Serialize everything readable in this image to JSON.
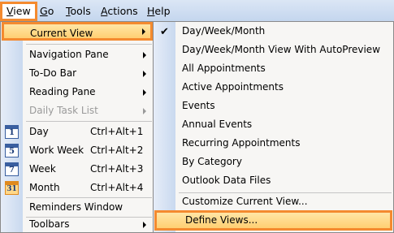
{
  "menubar": {
    "items": [
      {
        "label": "View",
        "accel": "V"
      },
      {
        "label": "Go",
        "accel": "G"
      },
      {
        "label": "Tools",
        "accel": "T"
      },
      {
        "label": "Actions",
        "accel": "A"
      },
      {
        "label": "Help",
        "accel": "H"
      }
    ]
  },
  "view_menu": {
    "items": [
      {
        "label": "Current View",
        "has_submenu": true,
        "highlighted": true
      },
      {
        "label": "Navigation Pane",
        "has_submenu": true
      },
      {
        "label": "To-Do Bar",
        "has_submenu": true
      },
      {
        "label": "Reading Pane",
        "has_submenu": true
      },
      {
        "label": "Daily Task List",
        "has_submenu": true,
        "disabled": true
      },
      {
        "label": "Day",
        "shortcut": "Ctrl+Alt+1",
        "icon": "calendar-day-icon",
        "icon_text": "1"
      },
      {
        "label": "Work Week",
        "shortcut": "Ctrl+Alt+2",
        "icon": "calendar-work-week-icon",
        "icon_text": "5"
      },
      {
        "label": "Week",
        "shortcut": "Ctrl+Alt+3",
        "icon": "calendar-week-icon",
        "icon_text": "7"
      },
      {
        "label": "Month",
        "shortcut": "Ctrl+Alt+4",
        "icon": "calendar-month-icon",
        "icon_text": "31",
        "icon_active": true
      },
      {
        "label": "Reminders Window"
      },
      {
        "label": "Toolbars",
        "has_submenu": true
      }
    ]
  },
  "current_view_menu": {
    "items": [
      {
        "label": "Day/Week/Month",
        "checked": true
      },
      {
        "label": "Day/Week/Month View With AutoPreview"
      },
      {
        "label": "All Appointments"
      },
      {
        "label": "Active Appointments"
      },
      {
        "label": "Events"
      },
      {
        "label": "Annual Events"
      },
      {
        "label": "Recurring Appointments"
      },
      {
        "label": "By Category"
      },
      {
        "label": "Outlook Data Files"
      },
      {
        "label": "Customize Current View..."
      },
      {
        "label": "Define Views...",
        "highlighted": true
      }
    ]
  },
  "colors": {
    "highlight_border": "#f48a2f",
    "highlight_fill": "#ffd88a",
    "menubar": "#c4d6ee"
  }
}
